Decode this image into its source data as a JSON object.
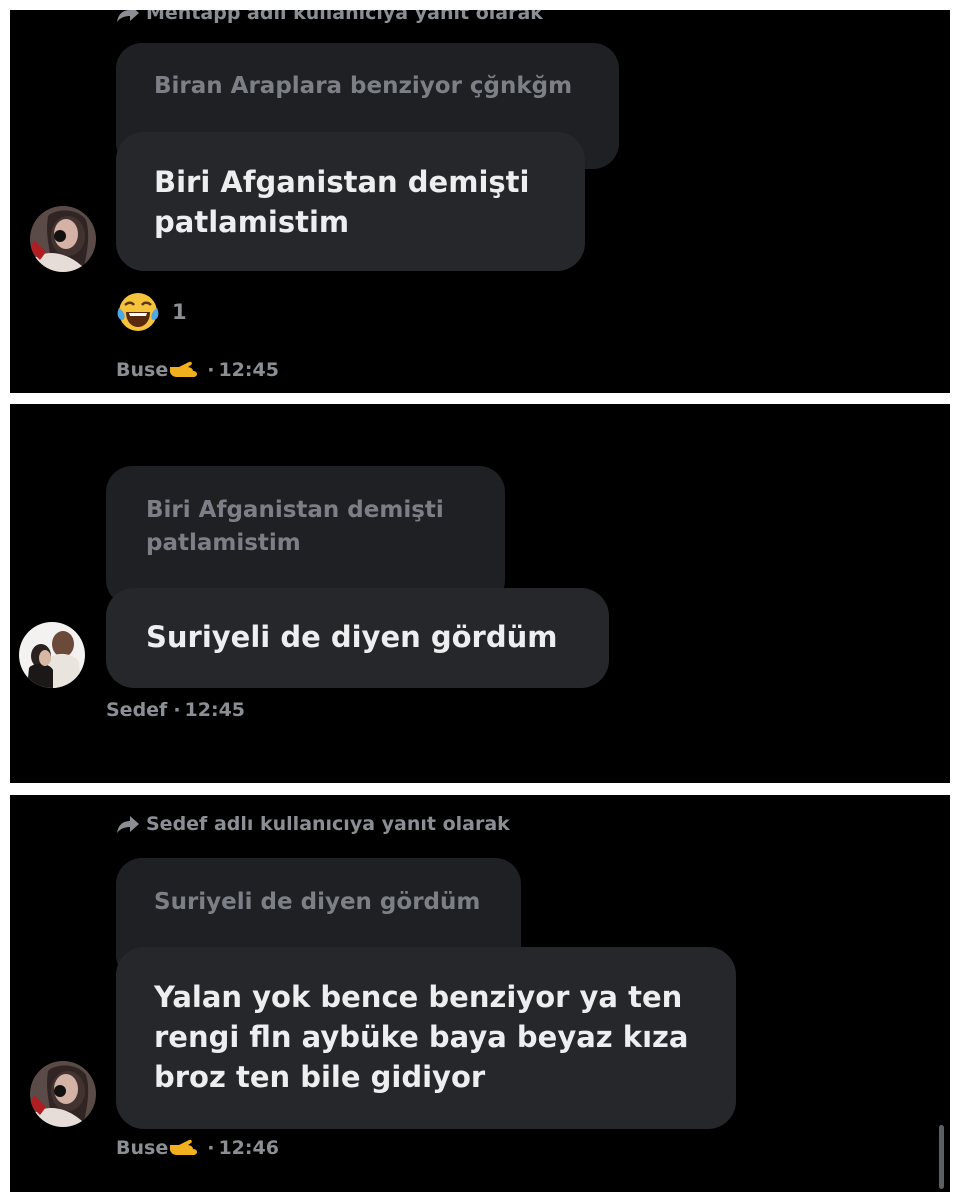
{
  "panels": [
    {
      "reply_header": "Mentapp adlı kullanıcıya yanıt olarak",
      "quoted_text": "Biran Araplara benziyor çğnkğm",
      "message_line1": "Biri Afganistan demişti",
      "message_line2": "patlamistim",
      "reaction_count": "1",
      "sender": "Buse",
      "time": "12:45"
    },
    {
      "quoted_line1": "Biri Afganistan demişti",
      "quoted_line2": "patlamistim",
      "message": "Suriyeli de diyen gördüm",
      "sender": "Sedef",
      "time": "12:45"
    },
    {
      "reply_header": "Sedef adlı kullanıcıya yanıt olarak",
      "quoted_text": "Suriyeli de diyen gördüm",
      "message_line1": "Yalan yok bence benziyor ya ten",
      "message_line2": "rengi fln aybüke baya beyaz kıza",
      "message_line3": "broz ten bile gidiyor",
      "sender": "Buse",
      "time": "12:46"
    }
  ],
  "separator": "·",
  "icons": {
    "reply": "reply-arrow-icon",
    "sender_badge": "pointing-hand-emoji",
    "reaction": "tears-of-joy-emoji"
  },
  "colors": {
    "background": "#000000",
    "bubble": "#25272b",
    "quoted_bubble": "#1e2023",
    "muted_text": "#8b8f94"
  }
}
